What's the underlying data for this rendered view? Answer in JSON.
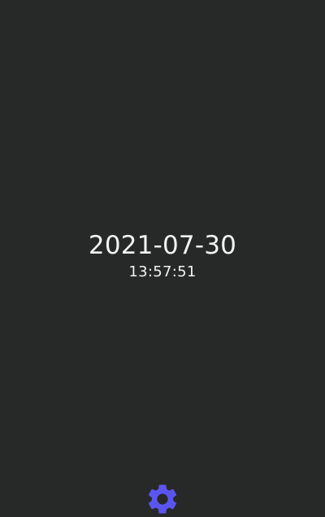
{
  "clock": {
    "date": "2021-07-30",
    "time": "13:57:51"
  },
  "settings": {
    "icon": "gear-icon",
    "color": "#5b55f0"
  },
  "colors": {
    "background": "#272928",
    "text": "#f2f2f2"
  }
}
